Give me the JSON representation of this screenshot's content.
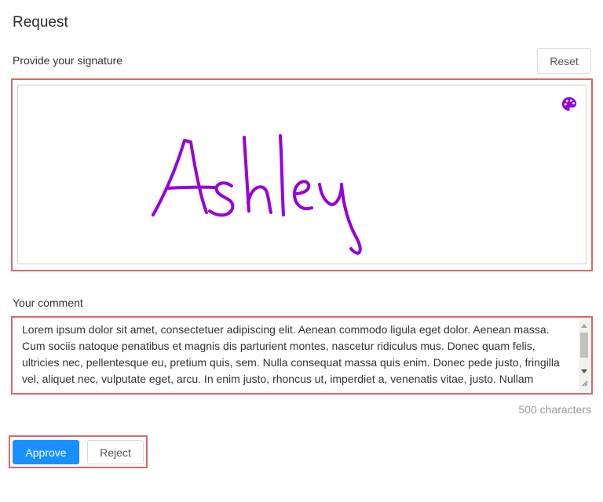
{
  "page": {
    "title": "Request"
  },
  "signature": {
    "label": "Provide your signature",
    "reset_label": "Reset",
    "signed_name": "Ashley",
    "ink_color": "#9500dd",
    "palette_icon": "palette-icon"
  },
  "comment": {
    "label": "Your comment",
    "text": "Lorem ipsum dolor sit amet, consectetuer adipiscing elit. Aenean commodo ligula eget dolor. Aenean massa. Cum sociis natoque penatibus et magnis dis parturient montes, nascetur ridiculus mus. Donec quam felis, ultricies nec, pellentesque eu, pretium quis, sem. Nulla consequat massa quis enim. Donec pede justo, fringilla vel, aliquet nec, vulputate eget, arcu. In enim justo, rhoncus ut, imperdiet a, venenatis vitae, justo. Nullam",
    "char_count": "500 characters"
  },
  "actions": {
    "approve_label": "Approve",
    "reject_label": "Reject"
  },
  "colors": {
    "primary": "#1890ff",
    "highlight": "#e06666",
    "ink": "#9500dd"
  }
}
